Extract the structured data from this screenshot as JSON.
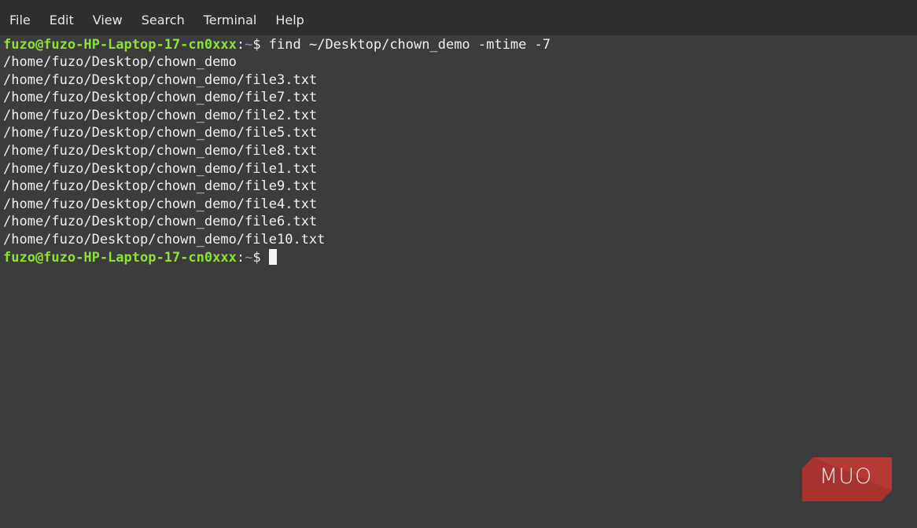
{
  "menubar": {
    "items": [
      "File",
      "Edit",
      "View",
      "Search",
      "Terminal",
      "Help"
    ]
  },
  "terminal": {
    "prompt_user_host": "fuzo@fuzo-HP-Laptop-17-cn0xxx",
    "prompt_sep": ":",
    "prompt_path": "~",
    "prompt_symbol": "$",
    "command": " find ~/Desktop/chown_demo -mtime -7",
    "output": [
      "/home/fuzo/Desktop/chown_demo",
      "/home/fuzo/Desktop/chown_demo/file3.txt",
      "/home/fuzo/Desktop/chown_demo/file7.txt",
      "/home/fuzo/Desktop/chown_demo/file2.txt",
      "/home/fuzo/Desktop/chown_demo/file5.txt",
      "/home/fuzo/Desktop/chown_demo/file8.txt",
      "/home/fuzo/Desktop/chown_demo/file1.txt",
      "/home/fuzo/Desktop/chown_demo/file9.txt",
      "/home/fuzo/Desktop/chown_demo/file4.txt",
      "/home/fuzo/Desktop/chown_demo/file6.txt",
      "/home/fuzo/Desktop/chown_demo/file10.txt"
    ]
  },
  "watermark": {
    "logo_text": "MUO",
    "color": "#a8322d"
  },
  "colors": {
    "background": "#3c3c3c",
    "menubar": "#2e2e2e",
    "prompt_user": "#8ae234",
    "prompt_path": "#7b9cc7"
  }
}
